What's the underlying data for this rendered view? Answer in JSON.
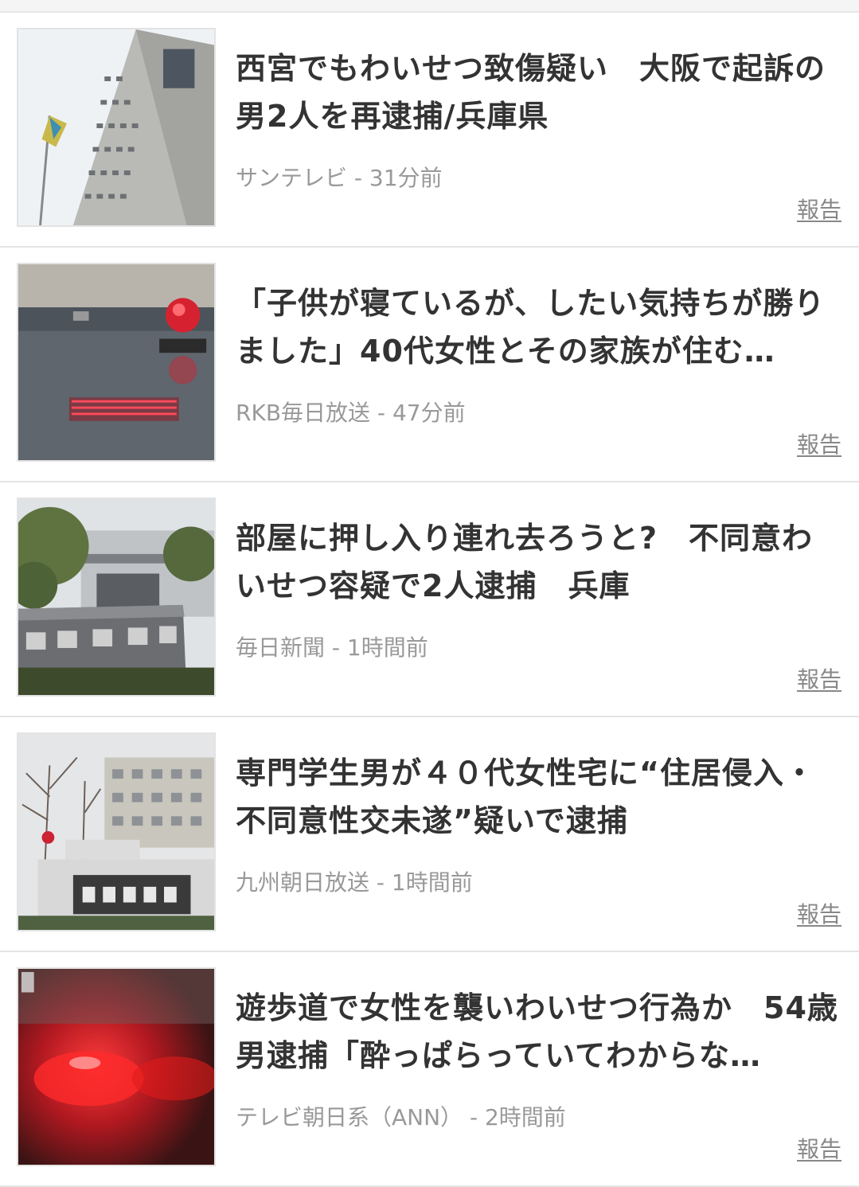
{
  "articles": [
    {
      "title": "西宮でもわいせつ致傷疑い　大阪で起訴の男2人を再逮捕/兵庫県",
      "source": "サンテレビ",
      "time": "31分前",
      "report_label": "報告",
      "thumb_icon": "office-building-photo"
    },
    {
      "title": "「子供が寝ているが、したい気持ちが勝りました」40代女性とその家族が住む…",
      "source": "RKB毎日放送",
      "time": "47分前",
      "report_label": "報告",
      "thumb_icon": "police-car-siren-photo"
    },
    {
      "title": "部屋に押し入り連れ去ろうと?　不同意わいせつ容疑で2人逮捕　兵庫",
      "source": "毎日新聞",
      "time": "1時間前",
      "report_label": "報告",
      "thumb_icon": "police-headquarters-sign-photo"
    },
    {
      "title": "専門学生男が４０代女性宅に“住居侵入・不同意性交未遂”疑いで逮捕",
      "source": "九州朝日放送",
      "time": "1時間前",
      "report_label": "報告",
      "thumb_icon": "police-station-photo"
    },
    {
      "title": "遊歩道で女性を襲いわいせつ行為か　54歳男逮捕「酔っぱらっていてわからな…",
      "source": "テレビ朝日系（ANN）",
      "time": "2時間前",
      "report_label": "報告",
      "thumb_icon": "red-siren-blur-photo"
    }
  ],
  "meta_separator": " - ",
  "colors": {
    "title": "#333333",
    "meta": "#999999",
    "report": "#888888",
    "divider": "#e4e4e4"
  }
}
